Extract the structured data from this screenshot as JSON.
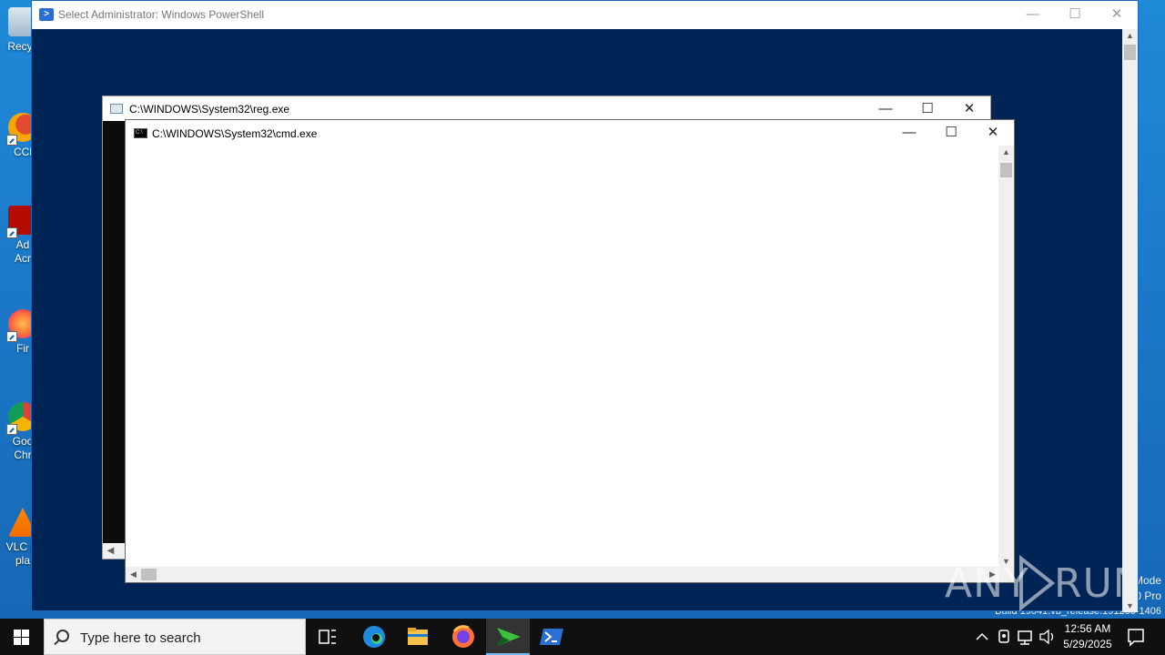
{
  "desktop": {
    "icons": [
      {
        "name": "Recycle Bin",
        "label": "Recyc"
      },
      {
        "name": "CCleaner",
        "label": "CCl"
      },
      {
        "name": "Adobe Acrobat",
        "label": "Ad\nAcr"
      },
      {
        "name": "Firefox",
        "label": "Fir"
      },
      {
        "name": "Google Chrome",
        "label": "Goo\nChr"
      },
      {
        "name": "VLC media player",
        "label": "VLC m\npla"
      }
    ],
    "watermark": {
      "line1": "Mode",
      "line2": "0 Pro",
      "line3": "Build 19041.vb_release.191206-1406"
    },
    "logo_text": "ANY RUN"
  },
  "powershell_window": {
    "title": "Select Administrator: Windows PowerShell",
    "minimize": "—",
    "maximize": "☐",
    "close": "✕",
    "bg_color": "#012456"
  },
  "reg_window": {
    "title": "C:\\WINDOWS\\System32\\reg.exe",
    "minimize": "—",
    "maximize": "☐",
    "close": "✕"
  },
  "cmd_window": {
    "title": "C:\\WINDOWS\\System32\\cmd.exe",
    "minimize": "—",
    "maximize": "☐",
    "close": "✕",
    "icon_text": "C:\\"
  },
  "taskbar": {
    "search_placeholder": "Type here to search",
    "apps": [
      "Task View",
      "Microsoft Edge",
      "File Explorer",
      "Firefox",
      "ANY.RUN",
      "Windows PowerShell"
    ],
    "active_app": "ANY.RUN",
    "clock_time": "12:56 AM",
    "clock_date": "5/29/2025"
  }
}
